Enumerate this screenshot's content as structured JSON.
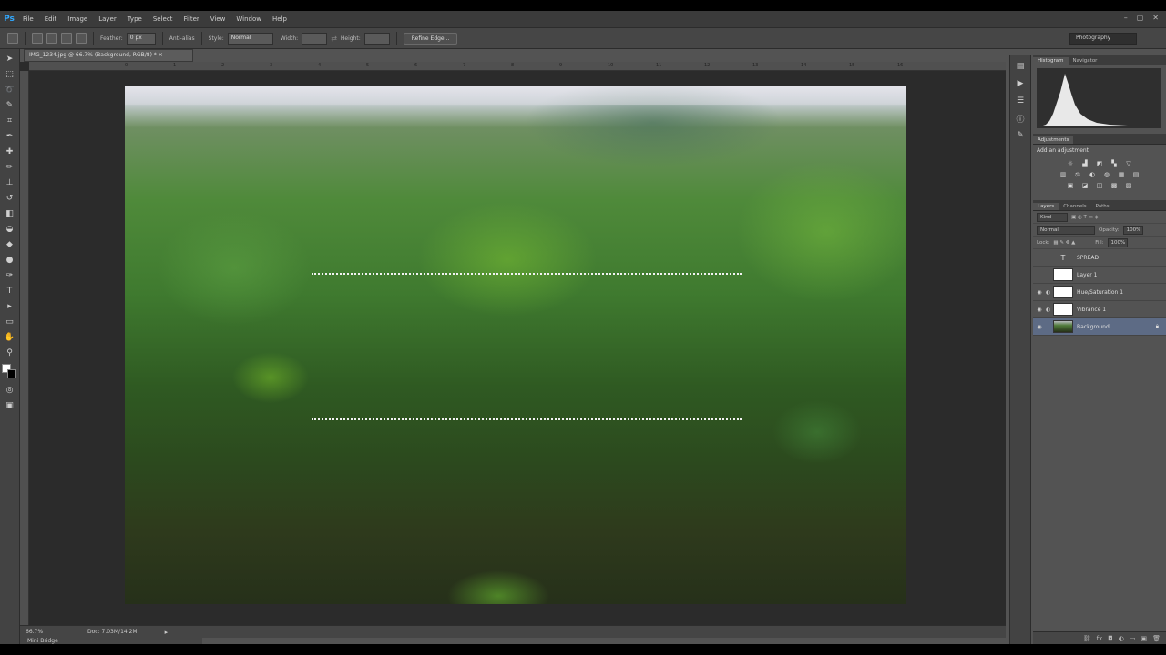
{
  "app": {
    "logo": "Ps"
  },
  "menu": {
    "items": [
      "File",
      "Edit",
      "Image",
      "Layer",
      "Type",
      "Select",
      "Filter",
      "View",
      "Window",
      "Help"
    ]
  },
  "window_controls": {
    "minimize": "–",
    "restore": "▢",
    "close": "✕"
  },
  "options_bar": {
    "feather_label": "Feather:",
    "feather_value": "0 px",
    "antialias_label": "Anti-alias",
    "style_label": "Style:",
    "style_value": "Normal",
    "width_label": "Width:",
    "height_label": "Height:",
    "refine_edge_label": "Refine Edge...",
    "workspace_value": "Photography"
  },
  "document": {
    "tab_title": "IMG_1234.jpg @ 66.7% (Background, RGB/8) * ×",
    "ruler_ticks": [
      "0",
      "1",
      "2",
      "3",
      "4",
      "5",
      "6",
      "7",
      "8",
      "9",
      "10",
      "11",
      "12",
      "13",
      "14",
      "15",
      "16"
    ]
  },
  "status": {
    "zoom": "66.7%",
    "doc_info": "Doc: 7.03M/14.2M",
    "minibridge": "Mini Bridge"
  },
  "panels": {
    "histogram_tabs": [
      "Histogram",
      "Navigator"
    ],
    "adjustments_tab": "Adjustments",
    "adjustments_title": "Add an adjustment",
    "adjustment_icons": [
      [
        "☼",
        "▟",
        "◩",
        "▚",
        "▽"
      ],
      [
        "▥",
        "⚖",
        "◐",
        "◍",
        "▦",
        "▤"
      ],
      [
        "▣",
        "◪",
        "◫",
        "▩",
        "▨"
      ]
    ],
    "layers_tabs": [
      "Layers",
      "Channels",
      "Paths"
    ],
    "kind_label": "Kind",
    "blend_mode": "Normal",
    "opacity_label": "Opacity:",
    "opacity_value": "100%",
    "lock_label": "Lock:",
    "fill_label": "Fill:",
    "fill_value": "100%",
    "layers": [
      {
        "name": "SPREAD",
        "thumb": "text",
        "visible": false,
        "selected": false
      },
      {
        "name": "Layer 1",
        "thumb": "white",
        "visible": false,
        "selected": false
      },
      {
        "name": "Hue/Saturation 1",
        "thumb": "white",
        "visible": true,
        "selected": false
      },
      {
        "name": "Vibrance 1",
        "thumb": "white",
        "visible": true,
        "selected": false
      },
      {
        "name": "Background",
        "thumb": "photo",
        "visible": true,
        "selected": true
      }
    ]
  }
}
